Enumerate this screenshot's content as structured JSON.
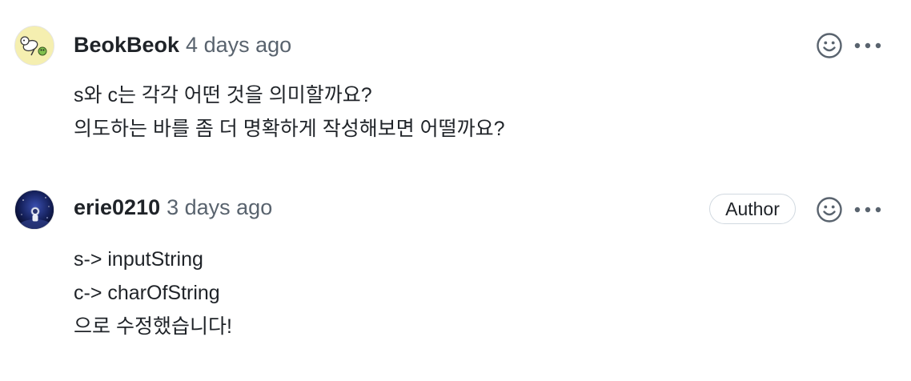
{
  "comments": [
    {
      "author": "BeokBeok",
      "timestamp": "4 days ago",
      "badge": "",
      "avatar_icon": "otter-avatar-icon",
      "lines": [
        "s와 c는 각각 어떤 것을 의미할까요?",
        "의도하는 바를 좀 더 명확하게 작성해보면 어떨까요?"
      ]
    },
    {
      "author": "erie0210",
      "timestamp": "3 days ago",
      "badge": "Author",
      "avatar_icon": "astronaut-avatar-icon",
      "lines": [
        "s-> inputString",
        "c-> charOfString",
        "으로 수정했습니다!"
      ]
    }
  ],
  "icons": {
    "reaction": "smiley-icon",
    "more": "kebab-horizontal-icon"
  },
  "colors": {
    "text": "#1f2328",
    "muted": "#59636e",
    "border": "#d1d9e0",
    "avatar1_bg": "#f5efb0",
    "avatar2_bg": "#0b1640"
  }
}
